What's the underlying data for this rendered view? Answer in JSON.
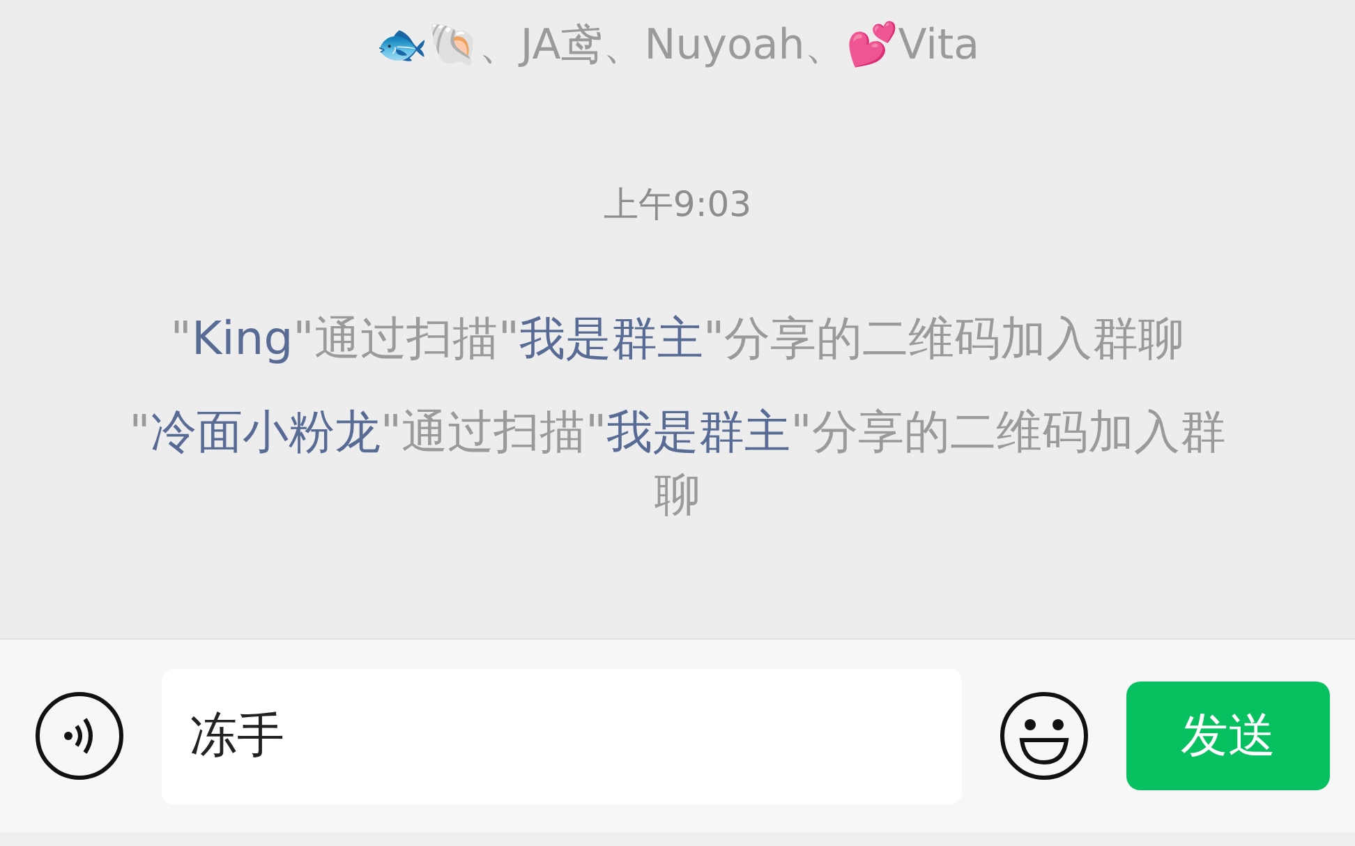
{
  "header": {
    "members": "🐟🐚、JA鸢、Nuyoah、💕Vita"
  },
  "timestamp": "上午9:03",
  "system_messages": [
    {
      "parts": [
        {
          "kind": "plain",
          "text": "\""
        },
        {
          "kind": "name",
          "text": "King"
        },
        {
          "kind": "plain",
          "text": "\"通过扫描\""
        },
        {
          "kind": "name",
          "text": "我是群主"
        },
        {
          "kind": "plain",
          "text": "\"分享的二维码加入群聊"
        }
      ]
    },
    {
      "parts": [
        {
          "kind": "plain",
          "text": "\""
        },
        {
          "kind": "name",
          "text": "冷面小粉龙"
        },
        {
          "kind": "plain",
          "text": "\"通过扫描\""
        },
        {
          "kind": "name",
          "text": "我是群主"
        },
        {
          "kind": "plain",
          "text": "\"分享的二维码加入群聊"
        }
      ]
    }
  ],
  "input": {
    "value": "冻手"
  },
  "send_button": "发送"
}
